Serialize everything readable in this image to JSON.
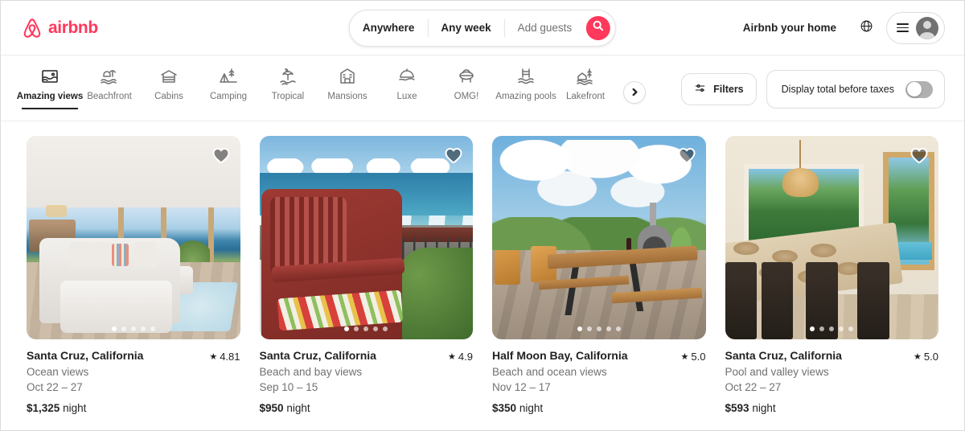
{
  "brand": {
    "name": "airbnb",
    "accent": "#FF385C",
    "logo_icon": "airbnb-belo-icon"
  },
  "header": {
    "search": {
      "location": "Anywhere",
      "dates": "Any week",
      "guests_placeholder": "Add guests",
      "search_icon": "search-icon"
    },
    "host_link": "Airbnb your home",
    "globe_icon": "globe-icon",
    "menu_icon": "hamburger-menu-icon",
    "avatar_icon": "user-avatar-icon"
  },
  "categories": {
    "active": "Amazing views",
    "items": [
      {
        "label": "Amazing views",
        "icon": "amazing-views-icon",
        "active": true
      },
      {
        "label": "Beachfront",
        "icon": "beachfront-icon",
        "active": false
      },
      {
        "label": "Cabins",
        "icon": "cabins-icon",
        "active": false
      },
      {
        "label": "Camping",
        "icon": "camping-icon",
        "active": false
      },
      {
        "label": "Tropical",
        "icon": "tropical-icon",
        "active": false
      },
      {
        "label": "Mansions",
        "icon": "mansions-icon",
        "active": false
      },
      {
        "label": "Luxe",
        "icon": "luxe-icon",
        "active": false
      },
      {
        "label": "OMG!",
        "icon": "omg-icon",
        "active": false
      },
      {
        "label": "Amazing pools",
        "icon": "amazing-pools-icon",
        "active": false
      },
      {
        "label": "Lakefront",
        "icon": "lakefront-icon",
        "active": false
      }
    ],
    "next_icon": "chevron-right-icon"
  },
  "toolbar": {
    "filters_label": "Filters",
    "filters_icon": "sliders-icon",
    "taxes_label": "Display total before taxes",
    "taxes_toggle_on": false
  },
  "listings": [
    {
      "title": "Santa Cruz, California",
      "rating": "4.81",
      "subtitle": "Ocean views",
      "dates": "Oct 22 – 27",
      "price": "$1,325",
      "price_unit": "night",
      "favorite_icon": "heart-icon",
      "photo_count": 5,
      "photo_index": 1,
      "photo_alt": "living room with white sectional sofa and ocean view windows"
    },
    {
      "title": "Santa Cruz, California",
      "rating": "4.9",
      "subtitle": "Beach and bay views",
      "dates": "Sep 10 – 15",
      "price": "$950",
      "price_unit": "night",
      "favorite_icon": "heart-icon",
      "photo_count": 5,
      "photo_index": 1,
      "photo_alt": "red wooden chair with striped cushion on balcony over ocean"
    },
    {
      "title": "Half Moon Bay, California",
      "rating": "5.0",
      "subtitle": "Beach and ocean views",
      "dates": "Nov 12 – 17",
      "price": "$350",
      "price_unit": "night",
      "favorite_icon": "heart-icon",
      "photo_count": 5,
      "photo_index": 1,
      "photo_alt": "outdoor picnic table with pizza oven near green hills and ocean"
    },
    {
      "title": "Santa Cruz, California",
      "rating": "5.0",
      "subtitle": "Pool and valley views",
      "dates": "Oct 22 – 27",
      "price": "$593",
      "price_unit": "night",
      "favorite_icon": "heart-icon",
      "photo_count": 5,
      "photo_index": 1,
      "photo_alt": "dining table with rattan pendant light and forest view"
    }
  ],
  "star_glyph": "★"
}
